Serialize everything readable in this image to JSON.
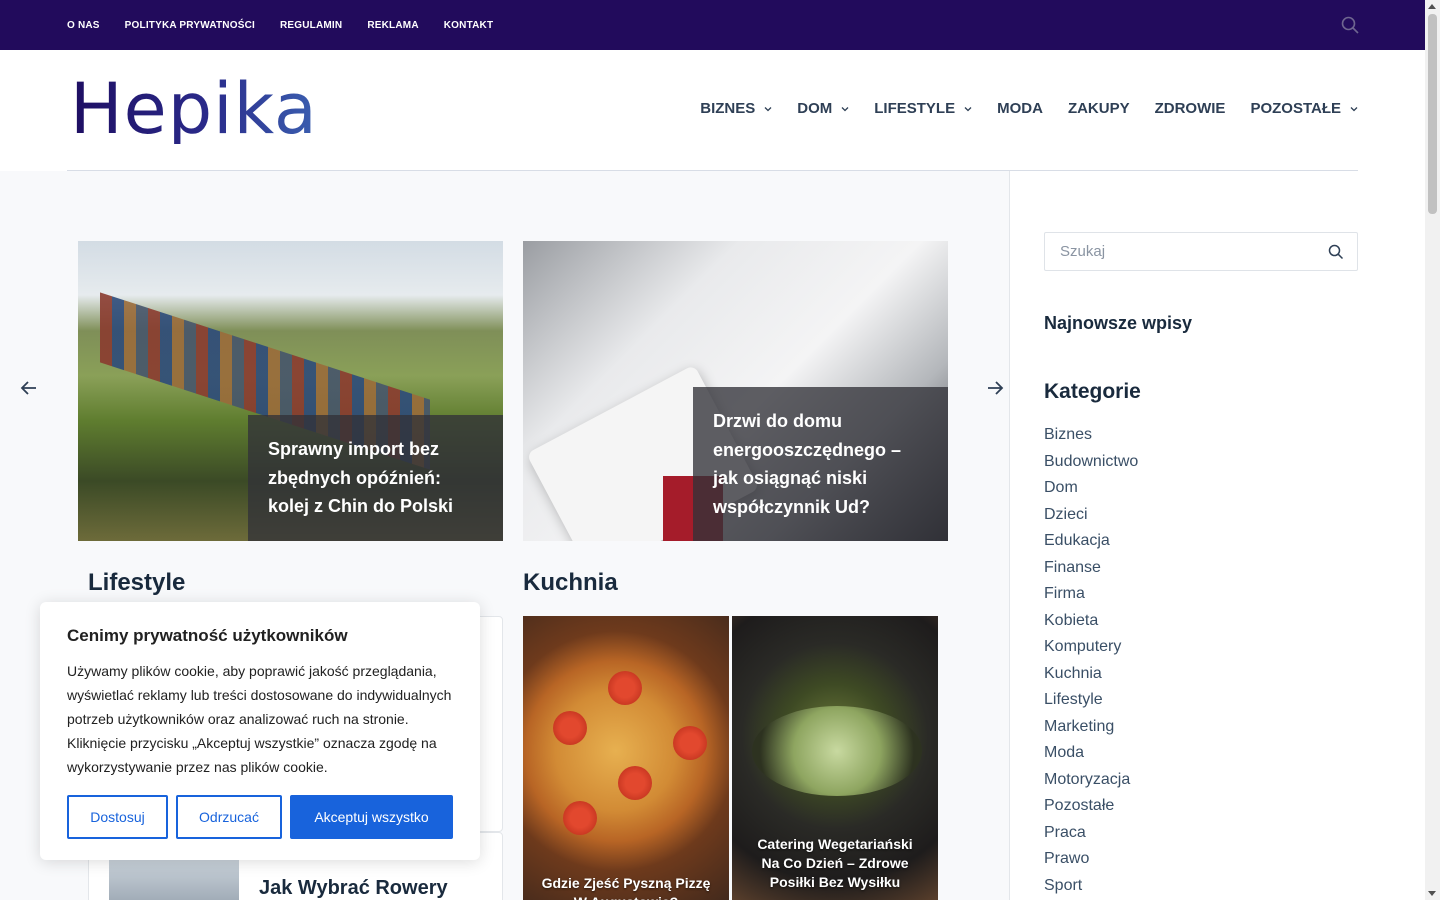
{
  "topbar": {
    "menu": [
      "O NAS",
      "POLITYKA PRYWATNOŚCI",
      "REGULAMIN",
      "REKLAMA",
      "KONTAKT"
    ]
  },
  "header": {
    "logo_text": "Hepika",
    "nav": [
      {
        "label": "BIZNES",
        "dropdown": true
      },
      {
        "label": "DOM",
        "dropdown": true
      },
      {
        "label": "LIFESTYLE",
        "dropdown": true
      },
      {
        "label": "MODA",
        "dropdown": false
      },
      {
        "label": "ZAKUPY",
        "dropdown": false
      },
      {
        "label": "ZDROWIE",
        "dropdown": false
      },
      {
        "label": "POZOSTAŁE",
        "dropdown": true
      }
    ]
  },
  "slider": {
    "slides": [
      {
        "title": "Sprawny import bez zbędnych opóźnień: kolej z Chin do Polski"
      },
      {
        "title": "Drzwi do domu energooszczędnego – jak osiągnąć niski współczynnik Ud?"
      }
    ]
  },
  "sections": {
    "lifestyle": {
      "title": "Lifestyle",
      "post2_title": "Jak Wybrać Rowery"
    },
    "kuchnia": {
      "title": "Kuchnia",
      "posts": [
        {
          "title": "Gdzie Zjeść Pyszną Pizzę W Augustowie?"
        },
        {
          "title": "Catering Wegetariański Na Co Dzień – Zdrowe Posiłki Bez Wysiłku"
        }
      ]
    }
  },
  "cookie": {
    "title": "Cenimy prywatność użytkowników",
    "text": "Używamy plików cookie, aby poprawić jakość przeglądania, wyświetlać reklamy lub treści dostosowane do indywidualnych potrzeb użytkowników oraz analizować ruch na stronie. Kliknięcie przycisku „Akceptuj wszystkie” oznacza zgodę na wykorzystywanie przez nas plików cookie.",
    "btn_customize": "Dostosuj",
    "btn_reject": "Odrzucać",
    "btn_accept": "Akceptuj wszystko"
  },
  "sidebar": {
    "search_placeholder": "Szukaj",
    "latest_title": "Najnowsze wpisy",
    "categories_title": "Kategorie",
    "categories": [
      "Biznes",
      "Budownictwo",
      "Dom",
      "Dzieci",
      "Edukacja",
      "Finanse",
      "Firma",
      "Kobieta",
      "Komputery",
      "Kuchnia",
      "Lifestyle",
      "Marketing",
      "Moda",
      "Motoryzacja",
      "Pozostałe",
      "Praca",
      "Prawo",
      "Sport"
    ]
  },
  "colors": {
    "topbar": "#220b5c",
    "accent_button": "#1863dc",
    "heading": "#192a3d"
  }
}
